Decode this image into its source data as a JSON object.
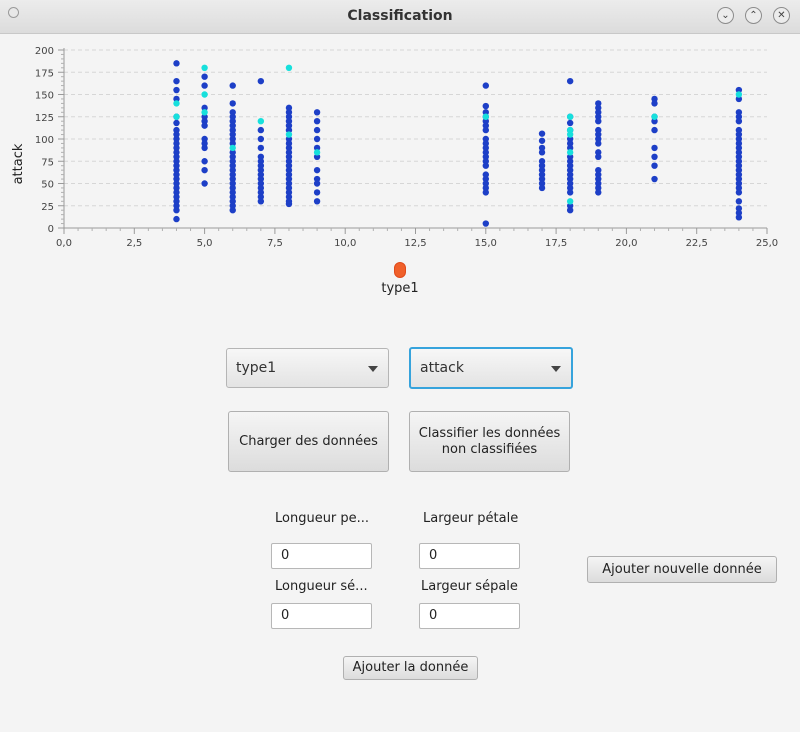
{
  "window": {
    "title": "Classification"
  },
  "chart_data": {
    "type": "scatter",
    "ylabel": "attack",
    "xlabel": "",
    "xlim": [
      0,
      25
    ],
    "ylim": [
      0,
      200
    ],
    "x_ticks": [
      "0,0",
      "2,5",
      "5,0",
      "7,5",
      "10,0",
      "12,5",
      "15,0",
      "17,5",
      "20,0",
      "22,5",
      "25,0"
    ],
    "y_ticks": [
      "0",
      "25",
      "50",
      "75",
      "100",
      "125",
      "150",
      "175",
      "200"
    ],
    "grid": "horizontal dashed",
    "legend": {
      "position": "bottom-center",
      "entries": [
        "type1"
      ]
    },
    "colors": {
      "classified": "#1d3fc7",
      "unclassified": "#17e0dc"
    },
    "series": [
      {
        "values": [
          [
            4,
            185
          ],
          [
            4,
            165
          ],
          [
            4,
            155
          ],
          [
            4,
            145
          ],
          [
            4,
            125
          ],
          [
            4,
            118
          ],
          [
            4,
            110
          ],
          [
            4,
            105
          ],
          [
            4,
            100
          ],
          [
            4,
            95
          ],
          [
            4,
            90
          ],
          [
            4,
            85
          ],
          [
            4,
            80
          ],
          [
            4,
            75
          ],
          [
            4,
            70
          ],
          [
            4,
            65
          ],
          [
            4,
            60
          ],
          [
            4,
            55
          ],
          [
            4,
            50
          ],
          [
            4,
            45
          ],
          [
            4,
            40
          ],
          [
            4,
            35
          ],
          [
            4,
            30
          ],
          [
            4,
            25
          ],
          [
            4,
            20
          ],
          [
            4,
            10
          ],
          [
            5,
            170
          ],
          [
            5,
            160
          ],
          [
            5,
            135
          ],
          [
            5,
            125
          ],
          [
            5,
            120
          ],
          [
            5,
            115
          ],
          [
            5,
            100
          ],
          [
            5,
            95
          ],
          [
            5,
            90
          ],
          [
            5,
            75
          ],
          [
            5,
            65
          ],
          [
            5,
            50
          ],
          [
            6,
            160
          ],
          [
            6,
            140
          ],
          [
            6,
            130
          ],
          [
            6,
            125
          ],
          [
            6,
            120
          ],
          [
            6,
            115
          ],
          [
            6,
            110
          ],
          [
            6,
            105
          ],
          [
            6,
            100
          ],
          [
            6,
            95
          ],
          [
            6,
            85
          ],
          [
            6,
            80
          ],
          [
            6,
            75
          ],
          [
            6,
            70
          ],
          [
            6,
            65
          ],
          [
            6,
            60
          ],
          [
            6,
            55
          ],
          [
            6,
            50
          ],
          [
            6,
            45
          ],
          [
            6,
            40
          ],
          [
            6,
            35
          ],
          [
            6,
            30
          ],
          [
            6,
            25
          ],
          [
            6,
            20
          ],
          [
            7,
            165
          ],
          [
            7,
            110
          ],
          [
            7,
            100
          ],
          [
            7,
            90
          ],
          [
            7,
            80
          ],
          [
            7,
            75
          ],
          [
            7,
            70
          ],
          [
            7,
            65
          ],
          [
            7,
            60
          ],
          [
            7,
            55
          ],
          [
            7,
            50
          ],
          [
            7,
            45
          ],
          [
            7,
            40
          ],
          [
            7,
            35
          ],
          [
            7,
            30
          ],
          [
            8,
            135
          ],
          [
            8,
            130
          ],
          [
            8,
            125
          ],
          [
            8,
            120
          ],
          [
            8,
            115
          ],
          [
            8,
            110
          ],
          [
            8,
            100
          ],
          [
            8,
            95
          ],
          [
            8,
            90
          ],
          [
            8,
            85
          ],
          [
            8,
            80
          ],
          [
            8,
            75
          ],
          [
            8,
            70
          ],
          [
            8,
            65
          ],
          [
            8,
            60
          ],
          [
            8,
            55
          ],
          [
            8,
            50
          ],
          [
            8,
            45
          ],
          [
            8,
            40
          ],
          [
            8,
            35
          ],
          [
            8,
            30
          ],
          [
            8,
            27
          ],
          [
            9,
            130
          ],
          [
            9,
            120
          ],
          [
            9,
            110
          ],
          [
            9,
            100
          ],
          [
            9,
            90
          ],
          [
            9,
            80
          ],
          [
            9,
            65
          ],
          [
            9,
            55
          ],
          [
            9,
            50
          ],
          [
            9,
            40
          ],
          [
            9,
            30
          ],
          [
            15,
            160
          ],
          [
            15,
            137
          ],
          [
            15,
            130
          ],
          [
            15,
            125
          ],
          [
            15,
            120
          ],
          [
            15,
            115
          ],
          [
            15,
            110
          ],
          [
            15,
            100
          ],
          [
            15,
            95
          ],
          [
            15,
            90
          ],
          [
            15,
            85
          ],
          [
            15,
            80
          ],
          [
            15,
            75
          ],
          [
            15,
            70
          ],
          [
            15,
            60
          ],
          [
            15,
            55
          ],
          [
            15,
            50
          ],
          [
            15,
            45
          ],
          [
            15,
            40
          ],
          [
            15,
            5
          ],
          [
            17,
            106
          ],
          [
            17,
            98
          ],
          [
            17,
            90
          ],
          [
            17,
            85
          ],
          [
            17,
            75
          ],
          [
            17,
            70
          ],
          [
            17,
            65
          ],
          [
            17,
            60
          ],
          [
            17,
            55
          ],
          [
            17,
            50
          ],
          [
            17,
            45
          ],
          [
            18,
            165
          ],
          [
            18,
            125
          ],
          [
            18,
            118
          ],
          [
            18,
            110
          ],
          [
            18,
            100
          ],
          [
            18,
            95
          ],
          [
            18,
            90
          ],
          [
            18,
            80
          ],
          [
            18,
            75
          ],
          [
            18,
            70
          ],
          [
            18,
            65
          ],
          [
            18,
            60
          ],
          [
            18,
            55
          ],
          [
            18,
            50
          ],
          [
            18,
            45
          ],
          [
            18,
            40
          ],
          [
            18,
            25
          ],
          [
            18,
            20
          ],
          [
            19,
            140
          ],
          [
            19,
            135
          ],
          [
            19,
            130
          ],
          [
            19,
            125
          ],
          [
            19,
            120
          ],
          [
            19,
            110
          ],
          [
            19,
            105
          ],
          [
            19,
            100
          ],
          [
            19,
            95
          ],
          [
            19,
            85
          ],
          [
            19,
            80
          ],
          [
            19,
            65
          ],
          [
            19,
            60
          ],
          [
            19,
            55
          ],
          [
            19,
            50
          ],
          [
            19,
            45
          ],
          [
            19,
            40
          ],
          [
            21,
            145
          ],
          [
            21,
            140
          ],
          [
            21,
            125
          ],
          [
            21,
            120
          ],
          [
            21,
            110
          ],
          [
            21,
            90
          ],
          [
            21,
            80
          ],
          [
            21,
            70
          ],
          [
            21,
            55
          ],
          [
            24,
            155
          ],
          [
            24,
            145
          ],
          [
            24,
            130
          ],
          [
            24,
            125
          ],
          [
            24,
            120
          ],
          [
            24,
            110
          ],
          [
            24,
            105
          ],
          [
            24,
            100
          ],
          [
            24,
            95
          ],
          [
            24,
            90
          ],
          [
            24,
            85
          ],
          [
            24,
            80
          ],
          [
            24,
            75
          ],
          [
            24,
            70
          ],
          [
            24,
            65
          ],
          [
            24,
            60
          ],
          [
            24,
            55
          ],
          [
            24,
            50
          ],
          [
            24,
            45
          ],
          [
            24,
            40
          ],
          [
            24,
            30
          ],
          [
            24,
            22
          ],
          [
            24,
            17
          ],
          [
            24,
            12
          ]
        ]
      },
      {
        "values": [
          [
            4,
            140
          ],
          [
            4,
            125
          ],
          [
            5,
            180
          ],
          [
            5,
            150
          ],
          [
            5,
            130
          ],
          [
            6,
            90
          ],
          [
            7,
            120
          ],
          [
            8,
            180
          ],
          [
            8,
            105
          ],
          [
            9,
            85
          ],
          [
            15,
            125
          ],
          [
            18,
            125
          ],
          [
            18,
            110
          ],
          [
            18,
            105
          ],
          [
            18,
            85
          ],
          [
            18,
            30
          ],
          [
            21,
            125
          ],
          [
            24,
            150
          ]
        ]
      }
    ]
  },
  "controls": {
    "x_select": "type1",
    "y_select": "attack",
    "load_button": "Charger des données",
    "classify_button_line1": "Classifier les données",
    "classify_button_line2": "non classifiées",
    "add_new_button": "Ajouter nouvelle donnée",
    "add_button": "Ajouter la donnée"
  },
  "form": {
    "petal_length_label": "Longueur pe...",
    "petal_width_label": "Largeur pétale",
    "sepal_length_label": "Longueur sé...",
    "sepal_width_label": "Largeur sépale",
    "petal_length_value": "0",
    "petal_width_value": "0",
    "sepal_length_value": "0",
    "sepal_width_value": "0"
  }
}
